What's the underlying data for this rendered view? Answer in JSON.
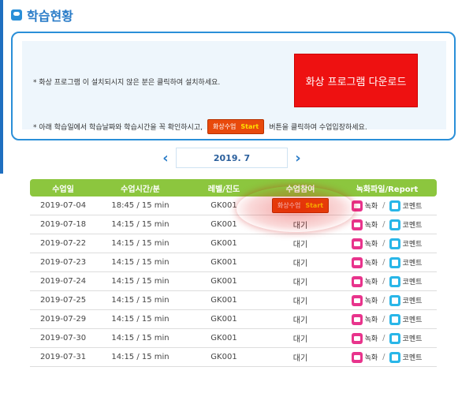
{
  "header": {
    "title": "학습현황"
  },
  "info": {
    "line1": "* 화상 프로그램 이 설치되시지 않은 분은 클릭하여 설치하세요.",
    "download_button": "화상 프로그램 다운로드",
    "line2_before": "* 아래 학습일에서 학습날짜와 학습시간을 꼭 확인하시고,",
    "line2_btn_label": "화상수업",
    "line2_btn_start": "Start",
    "line2_after": "버튼을 클릭하여 수업입장하세요."
  },
  "month_nav": {
    "label": "2019. 7",
    "prev": "‹",
    "next": "›"
  },
  "table": {
    "headers": [
      "수업일",
      "수업시간/분",
      "레벨/진도",
      "수업참여",
      "녹화파일/Report"
    ],
    "start_label": "화상수업",
    "start_word": "Start",
    "rec_label": "녹화",
    "comment_label": "코멘트",
    "slash": "/",
    "rows": [
      {
        "date": "2019-07-04",
        "time": "18:45 / 15 min",
        "level": "GK001",
        "status": ""
      },
      {
        "date": "2019-07-18",
        "time": "14:15 / 15 min",
        "level": "GK001",
        "status": "대기"
      },
      {
        "date": "2019-07-22",
        "time": "14:15 / 15 min",
        "level": "GK001",
        "status": "대기"
      },
      {
        "date": "2019-07-23",
        "time": "14:15 / 15 min",
        "level": "GK001",
        "status": "대기"
      },
      {
        "date": "2019-07-24",
        "time": "14:15 / 15 min",
        "level": "GK001",
        "status": "대기"
      },
      {
        "date": "2019-07-25",
        "time": "14:15 / 15 min",
        "level": "GK001",
        "status": "대기"
      },
      {
        "date": "2019-07-29",
        "time": "14:15 / 15 min",
        "level": "GK001",
        "status": "대기"
      },
      {
        "date": "2019-07-30",
        "time": "14:15 / 15 min",
        "level": "GK001",
        "status": "대기"
      },
      {
        "date": "2019-07-31",
        "time": "14:15 / 15 min",
        "level": "GK001",
        "status": "대기"
      }
    ]
  },
  "colors": {
    "accent_blue": "#2a8fd8",
    "header_green": "#8cc63e",
    "download_red": "#ee1111",
    "start_orange": "#e84a0c"
  }
}
